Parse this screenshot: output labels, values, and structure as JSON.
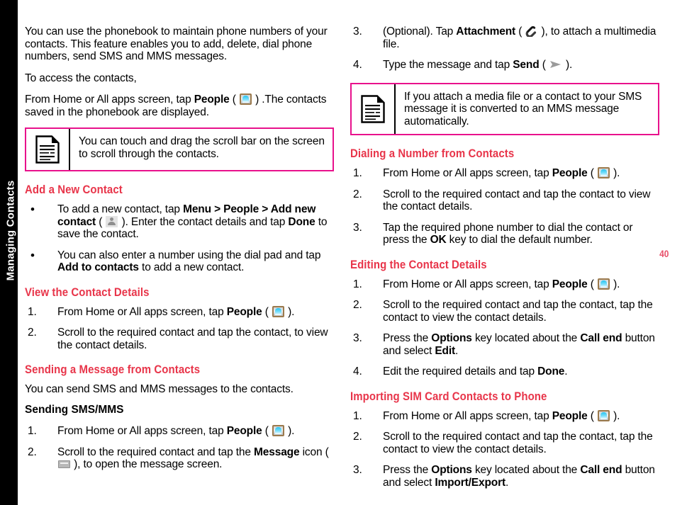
{
  "chapter": {
    "tab_label": "Managing Contacts"
  },
  "page_number": "40",
  "colors": {
    "heading_red": "#e8354a",
    "note_border_magenta": "#e8118c",
    "page_number_red": "#e8506a",
    "tab_background": "#000000"
  },
  "left_column": {
    "intro_paragraph": "You can use the phonebook to maintain phone numbers of your contacts. This feature enables you to add, delete, dial phone numbers, send SMS and MMS messages.",
    "access_line": "To access the contacts,",
    "people_line_pre": "From Home or All apps screen, tap ",
    "people_line_bold": "People",
    "people_line_paren_open": " ( ",
    "people_line_paren_close": " ) .The contacts saved in the phonebook are displayed.",
    "note": {
      "icon": "note-document-icon",
      "text": "You can touch and drag the scroll bar on the screen to scroll through the contacts."
    },
    "sections": [
      {
        "heading": "Add a New Contact",
        "bullets": [
          {
            "marker": "•",
            "pre": "To add a new contact, tap ",
            "bold1": "Menu > People > Add new contact",
            "mid": " ( ",
            "icon": "person-add-icon",
            "post1": " ). Enter the contact details and tap ",
            "bold2": "Done",
            "post2": " to save the contact."
          },
          {
            "marker": "•",
            "pre": "You can also enter a number using the dial pad and tap ",
            "bold1": "Add to contacts",
            "post1": " to add a new contact."
          }
        ]
      },
      {
        "heading": "View the Contact Details",
        "steps": [
          {
            "marker": "1.",
            "pre": "From Home or All apps screen, tap ",
            "bold1": "People",
            "mid": " ( ",
            "icon": "people-icon",
            "post1": " )."
          },
          {
            "marker": "2.",
            "pre": "Scroll to the required contact and tap the contact, to view the contact details."
          }
        ]
      },
      {
        "heading": "Sending a Message from Contacts",
        "paragraph": "You can send SMS and MMS messages to the contacts.",
        "subheading": "Sending SMS/MMS",
        "steps": [
          {
            "marker": "1.",
            "pre": "From Home or All apps screen, tap ",
            "bold1": "People",
            "mid": " ( ",
            "icon": "people-icon",
            "post1": " )."
          },
          {
            "marker": "2.",
            "pre": "Scroll to the required contact and tap the ",
            "bold1": "Message",
            "post1": " icon ( ",
            "icon": "message-icon",
            "post2": " ), to open the message screen."
          }
        ]
      }
    ]
  },
  "right_column": {
    "continued_steps": [
      {
        "marker": "3.",
        "pre": "(Optional). Tap ",
        "bold1": "Attachment",
        "mid": " ( ",
        "icon": "attachment-icon",
        "post1": " ), to attach a multimedia file."
      },
      {
        "marker": "4.",
        "pre": "Type the message and tap ",
        "bold1": "Send",
        "mid": " ( ",
        "icon": "send-icon",
        "post1": " )."
      }
    ],
    "note": {
      "icon": "note-document-icon",
      "text": "If you attach a media file or a contact to your SMS message it is converted to an MMS message automatically."
    },
    "sections": [
      {
        "heading": "Dialing a Number from Contacts",
        "steps": [
          {
            "marker": "1.",
            "pre": "From Home or All apps screen, tap ",
            "bold1": "People",
            "mid": " ( ",
            "icon": "people-icon",
            "post1": " )."
          },
          {
            "marker": "2.",
            "pre": "Scroll to the required contact and tap the contact to view the contact details."
          },
          {
            "marker": "3.",
            "pre": "Tap the required phone number to dial the contact or press the ",
            "bold1": "OK",
            "post1": " key to dial the default number."
          }
        ]
      },
      {
        "heading": "Editing the Contact Details",
        "steps": [
          {
            "marker": "1.",
            "pre": "From Home or All apps screen, tap ",
            "bold1": "People",
            "mid": " ( ",
            "icon": "people-icon",
            "post1": " )."
          },
          {
            "marker": "2.",
            "pre": "Scroll to the required contact and tap the contact, tap the contact to view the contact details."
          },
          {
            "marker": "3.",
            "pre": "Press the ",
            "bold1": "Options",
            "post1": " key located about the ",
            "bold2": "Call end",
            "post2": " button and select ",
            "bold3": "Edit",
            "post3": "."
          },
          {
            "marker": "4.",
            "pre": "Edit the required details and tap ",
            "bold1": "Done",
            "post1": "."
          }
        ]
      },
      {
        "heading": "Importing SIM Card Contacts to Phone",
        "steps": [
          {
            "marker": "1.",
            "pre": "From Home or All apps screen, tap ",
            "bold1": "People",
            "mid": " ( ",
            "icon": "people-icon",
            "post1": " )."
          },
          {
            "marker": "2.",
            "pre": "Scroll to the required contact and tap the contact, tap the contact to view the contact details."
          },
          {
            "marker": "3.",
            "pre": "Press the ",
            "bold1": "Options",
            "post1": " key located about the ",
            "bold2": "Call end",
            "post2": " button and select ",
            "bold3": "Import/Export",
            "post3": "."
          }
        ]
      }
    ]
  }
}
